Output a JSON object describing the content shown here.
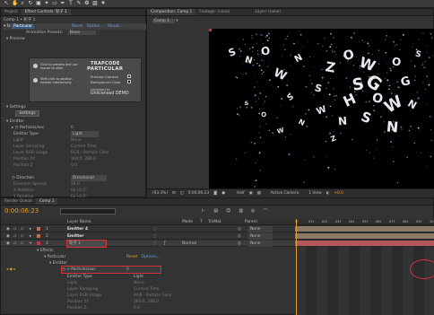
{
  "toolbar": {
    "tools": [
      "selection-tool",
      "hand-tool",
      "zoom-tool",
      "rotate-tool",
      "camera-tool",
      "pan-behind-tool",
      "mask-tool",
      "pen-tool",
      "type-tool",
      "brush-tool",
      "stamp-tool",
      "eraser-tool",
      "puppet-tool"
    ],
    "tool_glyphs": [
      "↖",
      "✋",
      "⌕",
      "↻",
      "▣",
      "✦",
      "▭",
      "✒",
      "T",
      "✎",
      "❂",
      "▨",
      "✷"
    ]
  },
  "effects_panel": {
    "tabs": [
      "Project",
      "Effect Controls: 轮子 1"
    ],
    "breadcrumb": "Comp 1 • 轮子 1",
    "effect_name": "Particular",
    "effect_links": [
      "Reset",
      "Option...",
      "About..."
    ],
    "animation_presets_label": "Animation Presets:",
    "animation_presets_value": "None",
    "preview_label": "Preview",
    "preview_hint_1": "Click to preview and use mouse to orbit",
    "preview_hint_2": "Shift-click to position emitter interactively",
    "brand_1": "TRAPCODE",
    "brand_2": "PARTICULAR",
    "preview_camera": "Preview Camera",
    "background_color": "Background Color",
    "licensed_to": "Licensed to",
    "unlicensed": "Unlicensed DEMO",
    "settings_section": "Settings",
    "settings_button": "Settings",
    "emitter_section": "Emitter",
    "particles_sec": "Particles/sec",
    "particles_sec_value": "0",
    "emitter_type_label": "Emitter Type",
    "emitter_type_value": "Light",
    "dim_rows": [
      {
        "label": "Light",
        "value": "None"
      },
      {
        "label": "Layer Sampling",
        "value": "Current Time"
      },
      {
        "label": "Layer RGB Usage",
        "value": "RGB - Particle Color"
      },
      {
        "label": "Position XY",
        "value": "360.0, 288.0"
      },
      {
        "label": "Position Z",
        "value": "0.0"
      }
    ],
    "direction_label": "Direction",
    "direction_value": "Directional",
    "dim_rows_2": [
      {
        "label": "Direction Spread",
        "value": "20.0"
      },
      {
        "label": "X Rotation",
        "value": "0x+0.0°"
      },
      {
        "label": "Y Rotation",
        "value": "0x+0.0°"
      }
    ]
  },
  "viewer": {
    "tabs": [
      "Composition: Comp 1",
      "Footage: (none)",
      "Layer: (none)"
    ],
    "comp_tab": "Comp 1",
    "status": {
      "zoom": "(93.3%)",
      "timecode": "0:00:06:23",
      "quality": "Half",
      "camera": "Active Camera",
      "view": "1 View",
      "exposure": "+0.0"
    },
    "particle_letters": [
      "S",
      "N",
      "O",
      "W",
      "N",
      "Z",
      "O",
      "W",
      "S",
      "G",
      "H",
      "O",
      "N",
      "S",
      "W",
      "S",
      "W",
      "O",
      "G",
      "N",
      "S",
      "N",
      "W",
      "O",
      "S",
      "N",
      "Z",
      "S"
    ]
  },
  "timeline": {
    "tabs": [
      "Render Queue",
      "Comp 1"
    ],
    "timecode": "0:00:06:23",
    "search_placeholder": "",
    "columns": [
      "Layer Name",
      "Mode",
      "T",
      "TrkMat",
      "Parent"
    ],
    "ruler_labels": [
      "0f",
      "01f",
      "02f",
      "03f",
      "04f",
      "05f",
      "06f",
      "07f",
      "08f",
      "09f",
      "10f"
    ],
    "layers": [
      {
        "num": "1",
        "name": "Emitter 4",
        "mode": "",
        "parent": "None"
      },
      {
        "num": "2",
        "name": "Emitter",
        "mode": "",
        "parent": "None"
      },
      {
        "num": "3",
        "name": "轮子 1",
        "mode": "Normal",
        "parent": "None"
      }
    ],
    "effects_label": "Effects",
    "particular_label": "Particular",
    "reset_label": "Reset",
    "options_label": "Options...",
    "emitter_label": "Emitter",
    "particles_sec_label": "Particles/sec",
    "particles_sec_value": "0",
    "sub_props": [
      {
        "label": "Emitter Type",
        "value": "Light"
      },
      {
        "label": "Light",
        "value": "None"
      },
      {
        "label": "Layer Sampling",
        "value": "Current Time"
      },
      {
        "label": "Layer RGB Usage",
        "value": "RGB - Particle Color"
      },
      {
        "label": "Position XY",
        "value": "360.0, 288.0"
      },
      {
        "label": "Position Z",
        "value": "0.0"
      }
    ]
  },
  "colors": {
    "accent": "#e59b2d",
    "selection_outline": "#d6303a",
    "track_red": "#b5585a",
    "track_tan": "#8a7a66"
  }
}
